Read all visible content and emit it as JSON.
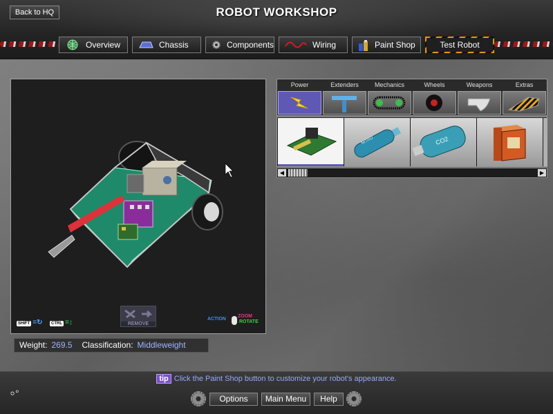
{
  "header": {
    "back_label": "Back to HQ",
    "title": "ROBOT WORKSHOP",
    "tabs": [
      {
        "label": "Overview",
        "icon": "globe-icon"
      },
      {
        "label": "Chassis",
        "icon": "chassis-icon"
      },
      {
        "label": "Components",
        "icon": "gear-icon"
      },
      {
        "label": "Wiring",
        "icon": "wire-icon"
      },
      {
        "label": "Paint Shop",
        "icon": "paint-cans-icon"
      },
      {
        "label": "Test Robot",
        "icon": "hazard-stripe"
      }
    ]
  },
  "viewport": {
    "hint_shift_key": "SHIFT",
    "hint_ctrl_key": "CTRL",
    "remove_label": "REMOVE",
    "zoom_label": "ZOOM",
    "action_label": "ACTION",
    "rotate_label": "ROTATE"
  },
  "stats": {
    "weight_label": "Weight:",
    "weight_value": "269.5",
    "class_label": "Classification:",
    "class_value": "Middleweight"
  },
  "parts_panel": {
    "categories": [
      {
        "label": "Power",
        "icon": "lightning-icon",
        "selected": true
      },
      {
        "label": "Extenders",
        "icon": "t-beam-icon",
        "selected": false
      },
      {
        "label": "Mechanics",
        "icon": "chain-drive-icon",
        "selected": false
      },
      {
        "label": "Wheels",
        "icon": "wheel-icon",
        "selected": false
      },
      {
        "label": "Weapons",
        "icon": "plow-blade-icon",
        "selected": false
      },
      {
        "label": "Extras",
        "icon": "hazard-wedge-icon",
        "selected": false
      }
    ],
    "items": [
      {
        "name": "circuit-board",
        "selected": true
      },
      {
        "name": "gas-tank",
        "tank_text": "NITRO",
        "selected": false
      },
      {
        "name": "co2-tank",
        "tank_text": "CO2",
        "selected": false
      },
      {
        "name": "battery",
        "selected": false
      }
    ]
  },
  "footer": {
    "tip_badge": "tip",
    "tip_text": "Click the Paint Shop button to customize your robot's appearance.",
    "options_label": "Options",
    "main_menu_label": "Main Menu",
    "help_label": "Help"
  }
}
